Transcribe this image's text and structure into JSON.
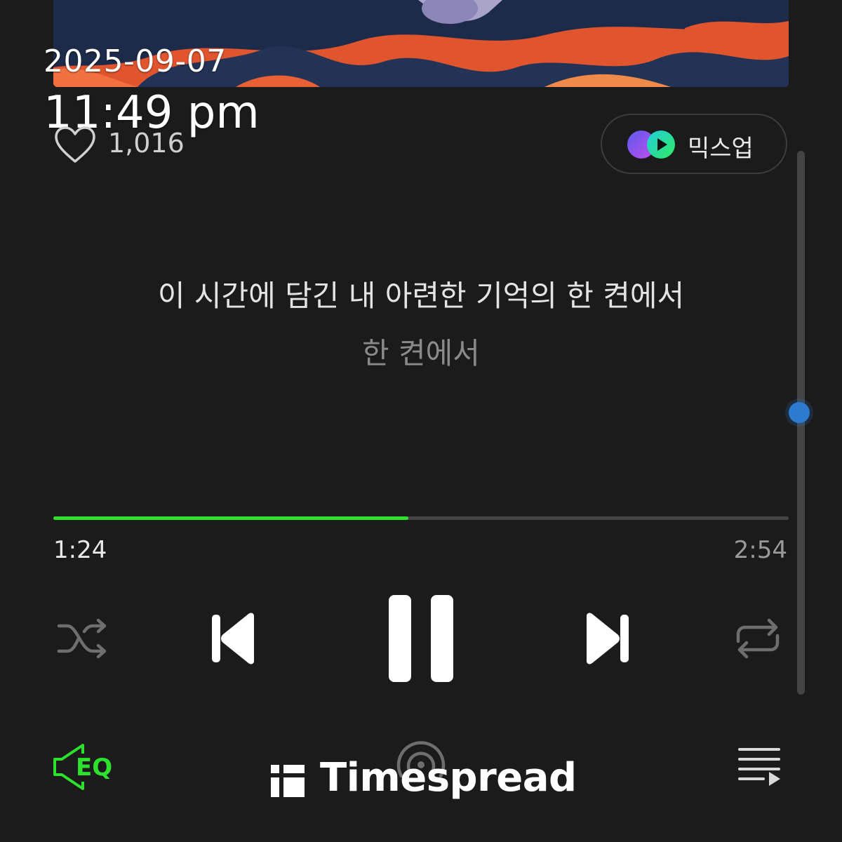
{
  "stamp": {
    "date": "2025-09-07",
    "time": "11:49 pm"
  },
  "like": {
    "count": "1,016"
  },
  "mixup": {
    "label": "믹스업"
  },
  "lyrics": {
    "current": "이 시간에 담긴 내 아련한 기억의 한 켠에서",
    "next": "한 켠에서"
  },
  "progress": {
    "current": "1:24",
    "total": "2:54",
    "fraction": 0.4828
  },
  "scroll_position": 0.48,
  "controls": {
    "shuffle": "shuffle-icon",
    "previous": "skip-previous-icon",
    "pause": "pause-icon",
    "next": "skip-next-icon",
    "repeat": "repeat-icon"
  },
  "bottom": {
    "eq_label": "EQ",
    "eq_color": "#2ee02e"
  },
  "watermark": {
    "text": "Timespread"
  },
  "colors": {
    "accent": "#2ee02e",
    "background": "#1b1b1b",
    "scroll_thumb": "#2d7bd0"
  }
}
